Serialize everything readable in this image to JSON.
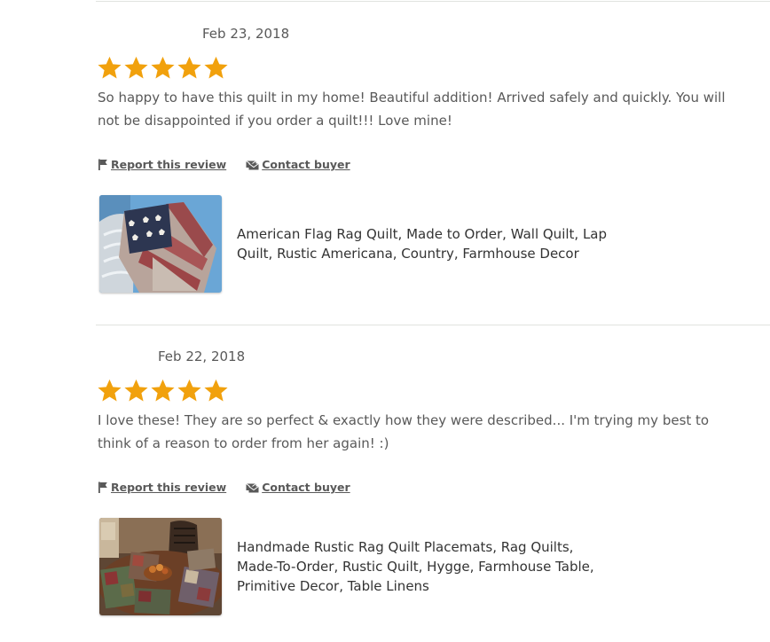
{
  "colors": {
    "star": "#f1a10d",
    "divider": "#e1e3df",
    "text": "#595959",
    "title": "#333333"
  },
  "reviews": [
    {
      "date": "Feb 23, 2018",
      "rating": 5,
      "rating_max": 5,
      "text": "So happy to have this quilt in my home! Beautiful addition! Arrived safely and quickly. You will not be disappointed if you order a quilt!!! Love mine!",
      "report_label": "Report this review",
      "contact_label": "Contact buyer",
      "product_title": "American Flag Rag Quilt, Made to Order, Wall Quilt, Lap Quilt, Rustic Americana, Country, Farmhouse Decor",
      "product_icon": "flag-quilt-photo"
    },
    {
      "date": "Feb 22, 2018",
      "rating": 5,
      "rating_max": 5,
      "text": "I love these! They are so perfect & exactly how they were described... I'm trying my best to think of a reason to order from her again! :)",
      "report_label": "Report this review",
      "contact_label": "Contact buyer",
      "product_title": "Handmade Rustic Rag Quilt Placemats, Rag Quilts, Made-To-Order, Rustic Quilt, Hygge, Farmhouse Table, Primitive Decor, Table Linens",
      "product_icon": "placemats-photo"
    }
  ]
}
